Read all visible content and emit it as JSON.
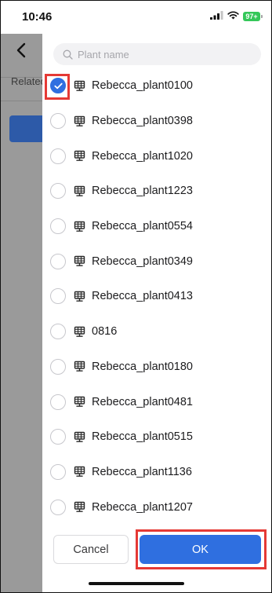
{
  "status_bar": {
    "time": "10:46",
    "battery": "97+"
  },
  "background_page": {
    "related_label": "Related"
  },
  "search": {
    "placeholder": "Plant name"
  },
  "plants": [
    {
      "name": "Rebecca_plant0100",
      "selected": true
    },
    {
      "name": "Rebecca_plant0398",
      "selected": false
    },
    {
      "name": "Rebecca_plant1020",
      "selected": false
    },
    {
      "name": "Rebecca_plant1223",
      "selected": false
    },
    {
      "name": "Rebecca_plant0554",
      "selected": false
    },
    {
      "name": "Rebecca_plant0349",
      "selected": false
    },
    {
      "name": "Rebecca_plant0413",
      "selected": false
    },
    {
      "name": "0816",
      "selected": false
    },
    {
      "name": "Rebecca_plant0180",
      "selected": false
    },
    {
      "name": "Rebecca_plant0481",
      "selected": false
    },
    {
      "name": "Rebecca_plant0515",
      "selected": false
    },
    {
      "name": "Rebecca_plant1136",
      "selected": false
    },
    {
      "name": "Rebecca_plant1207",
      "selected": false
    }
  ],
  "buttons": {
    "cancel": "Cancel",
    "ok": "OK"
  },
  "colors": {
    "accent": "#2f6fe0",
    "highlight": "#e53935",
    "overlay": "#9a9a9a"
  }
}
